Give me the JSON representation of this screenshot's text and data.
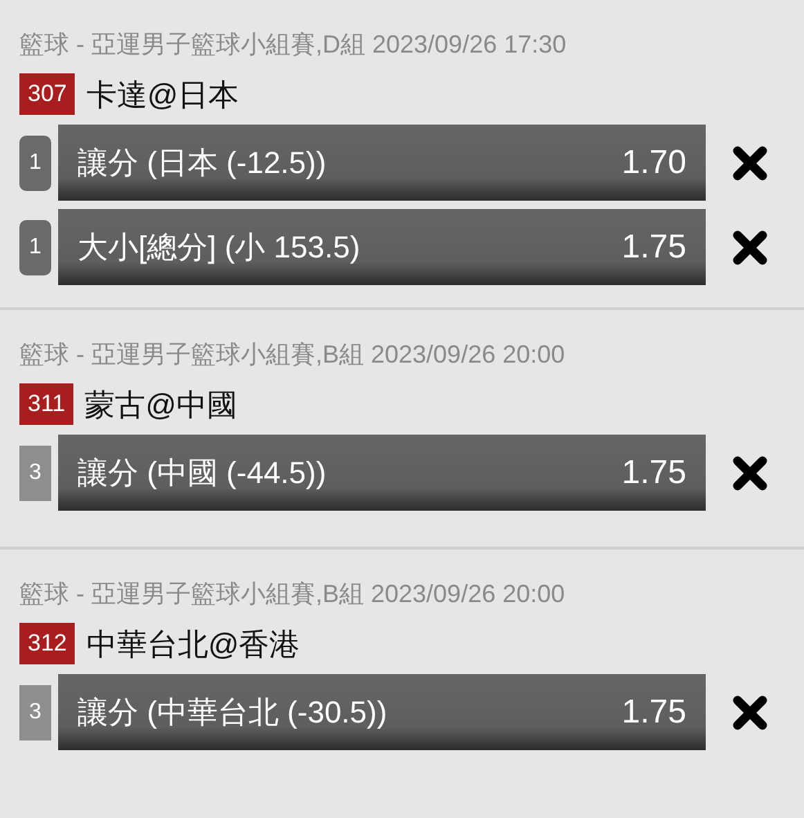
{
  "events": [
    {
      "header": "籃球 - 亞運男子籃球小組賽,D組 2023/09/26 17:30",
      "code": "307",
      "match": "卡達@日本",
      "bets": [
        {
          "count": "1",
          "kind": "rounded",
          "selection": "讓分 (日本 (-12.5))",
          "odds": "1.70"
        },
        {
          "count": "1",
          "kind": "rounded",
          "selection": "大小[總分] (小 153.5)",
          "odds": "1.75"
        }
      ]
    },
    {
      "header": "籃球 - 亞運男子籃球小組賽,B組 2023/09/26 20:00",
      "code": "311",
      "match": "蒙古@中國",
      "bets": [
        {
          "count": "3",
          "kind": "square",
          "selection": "讓分 (中國 (-44.5))",
          "odds": "1.75"
        }
      ]
    },
    {
      "header": "籃球 - 亞運男子籃球小組賽,B組 2023/09/26 20:00",
      "code": "312",
      "match": "中華台北@香港",
      "bets": [
        {
          "count": "3",
          "kind": "square",
          "selection": "讓分 (中華台北 (-30.5))",
          "odds": "1.75"
        }
      ]
    }
  ]
}
